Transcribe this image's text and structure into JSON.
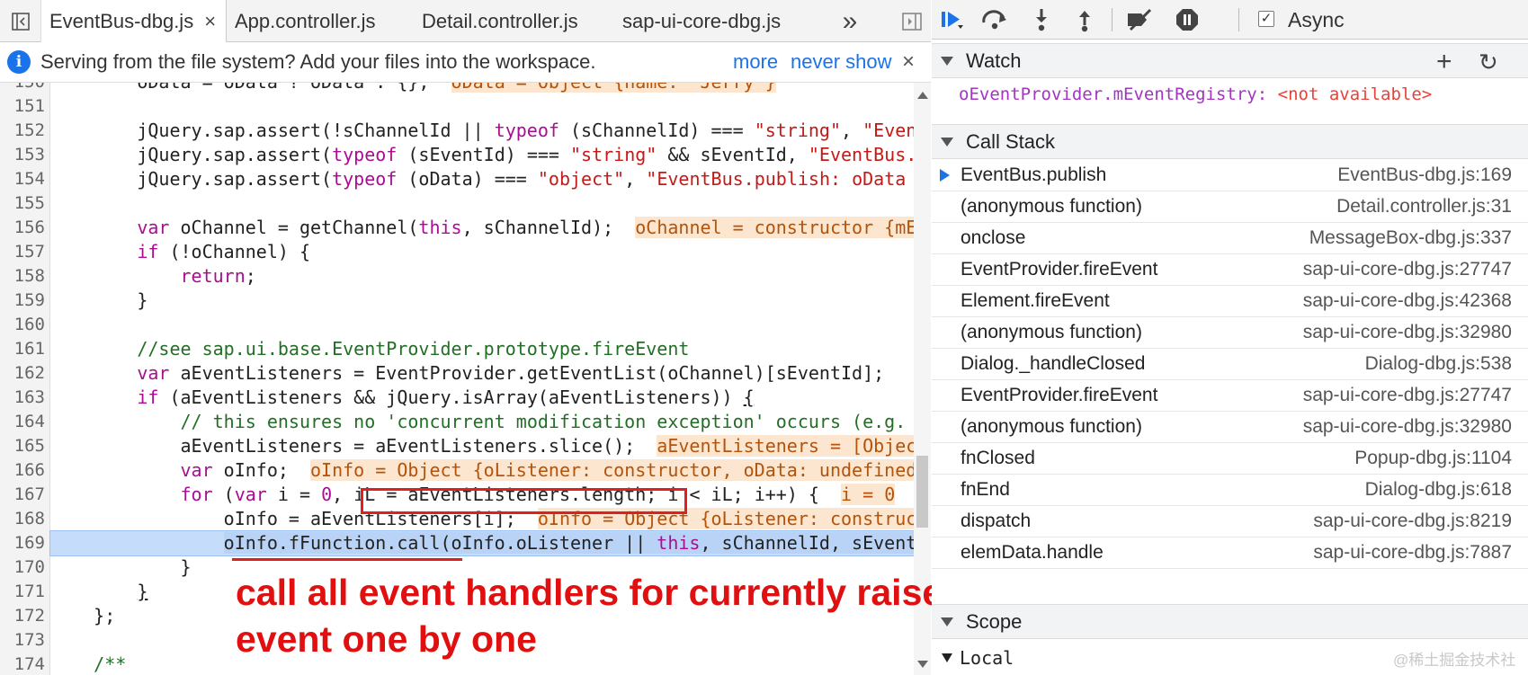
{
  "tabs": [
    {
      "label": "EventBus-dbg.js",
      "active": true
    },
    {
      "label": "App.controller.js",
      "active": false
    },
    {
      "label": "Detail.controller.js",
      "active": false
    },
    {
      "label": "sap-ui-core-dbg.js",
      "active": false
    }
  ],
  "tabs_overflow": "»",
  "tab_close": "×",
  "infobar": {
    "message": "Serving from the file system? Add your files into the workspace.",
    "more_link": "more",
    "never_link": "never show",
    "close": "×"
  },
  "editor": {
    "lines": [
      {
        "n": "150",
        "html": "        oData = oData ? oData : {};  <span class=\"inl\">oData = Object {name: \"Jerry\"}</span>"
      },
      {
        "n": "151",
        "html": ""
      },
      {
        "n": "152",
        "html": "        jQuery.sap.assert(!sChannelId || <span class=\"kw\">typeof</span> (sChannelId) === <span class=\"str\">\"string\"</span>, <span class=\"str\">\"EventBus.publish: sChannelId</span>"
      },
      {
        "n": "153",
        "html": "        jQuery.sap.assert(<span class=\"kw\">typeof</span> (sEventId) === <span class=\"str\">\"string\"</span> &amp;&amp; sEventId, <span class=\"str\">\"EventBus.publish</span>"
      },
      {
        "n": "154",
        "html": "        jQuery.sap.assert(<span class=\"kw\">typeof</span> (oData) === <span class=\"str\">\"object\"</span>, <span class=\"str\">\"EventBus.publish: oData must be</span>"
      },
      {
        "n": "155",
        "html": ""
      },
      {
        "n": "156",
        "html": "        <span class=\"kw\">var</span> oChannel = getChannel(<span class=\"kw\">this</span>, sChannelId);  <span class=\"inl\">oChannel = constructor {mEventRegistry</span>"
      },
      {
        "n": "157",
        "html": "        <span class=\"kw\">if</span> (!oChannel) {"
      },
      {
        "n": "158",
        "html": "            <span class=\"kw\">return</span>;"
      },
      {
        "n": "159",
        "html": "        }"
      },
      {
        "n": "160",
        "html": ""
      },
      {
        "n": "161",
        "html": "        <span class=\"cm\">//see sap.ui.base.EventProvider.prototype.fireEvent</span>"
      },
      {
        "n": "162",
        "html": "        <span class=\"kw\">var</span> aEventListeners = EventProvider.getEventList(oChannel)[sEventId];"
      },
      {
        "n": "163",
        "html": "        <span class=\"kw\">if</span> (aEventListeners &amp;&amp; jQuery.isArray(aEventListeners)) <u>{</u>"
      },
      {
        "n": "164",
        "html": "            <span class=\"cm\">// this ensures no 'concurrent modification exception' occurs (e.g.</span>"
      },
      {
        "n": "165",
        "html": "            aEventListeners = aEventListeners.slice();  <span class=\"inl\">aEventListeners = [Object]</span>"
      },
      {
        "n": "166",
        "html": "            <span class=\"kw\">var</span> oInfo;  <span class=\"inl\">oInfo = Object {oListener: constructor, oData: undefined</span>"
      },
      {
        "n": "167",
        "html": "            <span class=\"kw\">for</span> (<span class=\"kw\">var</span> i = <span class=\"kw\">0</span>, iL = aEventListeners.length; i &lt; iL; i++) {  <span class=\"inl\">i = 0</span>"
      },
      {
        "n": "168",
        "html": "                oInfo = aEventListeners[i];  <span class=\"inl\">oInfo = Object {oListener: constructor</span>"
      },
      {
        "n": "169",
        "html": "                <span class=\"sel\">oInfo.fFunction.call(oInfo.oListener || <span class=\"kw\">this</span>, sChannelId, sEventId</span>",
        "current": true
      },
      {
        "n": "170",
        "html": "            }"
      },
      {
        "n": "171",
        "html": "        <u>}</u>"
      },
      {
        "n": "172",
        "html": "    };"
      },
      {
        "n": "173",
        "html": ""
      },
      {
        "n": "174",
        "html": "    <span class=\"cm\">/**</span>"
      }
    ]
  },
  "annotation": "call all event handlers for currently raised\nevent one by one",
  "debugger": {
    "async_label": "Async",
    "async_checked": "✓",
    "watch": {
      "title": "Watch",
      "add": "+",
      "refresh": "↻",
      "expr": "oEventProvider.mEventRegistry",
      "sep": ": ",
      "value": "<not available>"
    },
    "call_stack": {
      "title": "Call Stack",
      "frames": [
        {
          "fn": "EventBus.publish",
          "loc": "EventBus-dbg.js:169",
          "current": true
        },
        {
          "fn": "(anonymous function)",
          "loc": "Detail.controller.js:31"
        },
        {
          "fn": "onclose",
          "loc": "MessageBox-dbg.js:337"
        },
        {
          "fn": "EventProvider.fireEvent",
          "loc": "sap-ui-core-dbg.js:27747"
        },
        {
          "fn": "Element.fireEvent",
          "loc": "sap-ui-core-dbg.js:42368"
        },
        {
          "fn": "(anonymous function)",
          "loc": "sap-ui-core-dbg.js:32980"
        },
        {
          "fn": "Dialog._handleClosed",
          "loc": "Dialog-dbg.js:538"
        },
        {
          "fn": "EventProvider.fireEvent",
          "loc": "sap-ui-core-dbg.js:27747"
        },
        {
          "fn": "(anonymous function)",
          "loc": "sap-ui-core-dbg.js:32980"
        },
        {
          "fn": "fnClosed",
          "loc": "Popup-dbg.js:1104"
        },
        {
          "fn": "fnEnd",
          "loc": "Dialog-dbg.js:618"
        },
        {
          "fn": "dispatch",
          "loc": "sap-ui-core-dbg.js:8219"
        },
        {
          "fn": "elemData.handle",
          "loc": "sap-ui-core-dbg.js:7887"
        }
      ]
    },
    "scope": {
      "title": "Scope",
      "local": "Local"
    }
  },
  "watermark": "@稀土掘金技术社区"
}
